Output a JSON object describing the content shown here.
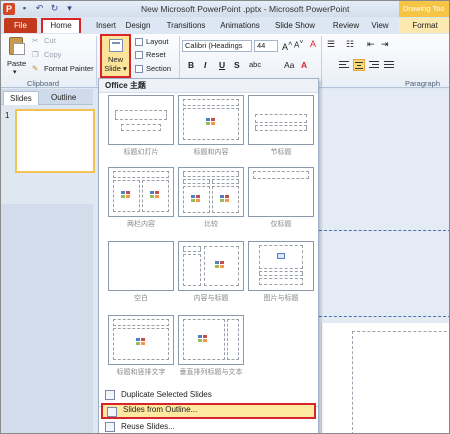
{
  "window": {
    "logo_letter": "P",
    "title": "New Microsoft PowerPoint .pptx - Microsoft PowerPoint",
    "contextual_title": "Drawing Too"
  },
  "tabs": [
    {
      "label": "File"
    },
    {
      "label": "Home"
    },
    {
      "label": "Insert"
    },
    {
      "label": "Design"
    },
    {
      "label": "Transitions"
    },
    {
      "label": "Animations"
    },
    {
      "label": "Slide Show"
    },
    {
      "label": "Review"
    },
    {
      "label": "View"
    },
    {
      "label": "Format"
    }
  ],
  "ribbon": {
    "clipboard": {
      "paste": "Paste",
      "cut": "Cut",
      "copy": "Copy",
      "format_painter": "Format Painter",
      "group_label": "Clipboard"
    },
    "slides": {
      "new_slide_line1": "New",
      "new_slide_line2": "Slide",
      "layout": "Layout",
      "reset": "Reset",
      "section": "Section"
    },
    "font": {
      "font_name": "Calibri (Headings",
      "font_size": "44",
      "bold": "B",
      "italic": "I",
      "underline": "U",
      "strike": "S"
    },
    "paragraph": {
      "group_label": "Paragraph"
    }
  },
  "left_panel": {
    "tab_slides": "Slides",
    "tab_outline": "Outline",
    "slide_number": "1"
  },
  "dropdown": {
    "header": "Office 主题",
    "layouts": [
      {
        "caption": "标题幻灯片"
      },
      {
        "caption": "标题和内容"
      },
      {
        "caption": "节标题"
      },
      {
        "caption": "两栏内容"
      },
      {
        "caption": "比较"
      },
      {
        "caption": "仅标题"
      },
      {
        "caption": "空白"
      },
      {
        "caption": "内容与标题"
      },
      {
        "caption": "图片与标题"
      },
      {
        "caption": "标题和竖排文字"
      },
      {
        "caption": "垂直排列标题与文本"
      }
    ],
    "menu": {
      "duplicate": "Duplicate Selected Slides",
      "from_outline": "Slides from Outline...",
      "reuse": "Reuse Slides..."
    }
  },
  "colors": {
    "file_tab": "#c23a1b",
    "highlight_border": "#d9252a",
    "menu_hover": "#fde99f",
    "contextual_tab": "#f6c545"
  }
}
